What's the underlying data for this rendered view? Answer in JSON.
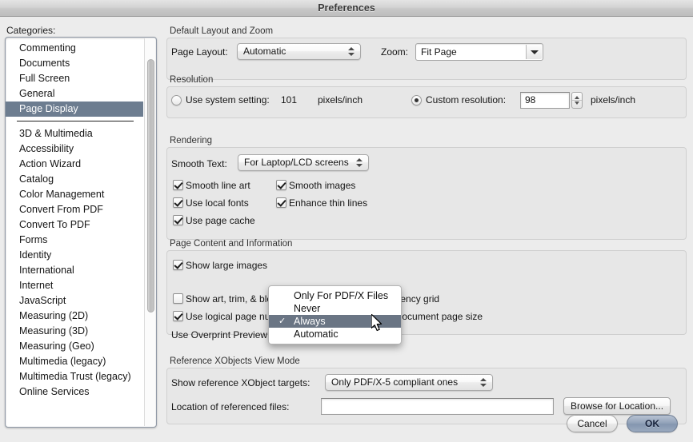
{
  "window": {
    "title": "Preferences"
  },
  "sidebar": {
    "label": "Categories:",
    "items": [
      {
        "label": "Commenting",
        "selected": false
      },
      {
        "label": "Documents",
        "selected": false
      },
      {
        "label": "Full Screen",
        "selected": false
      },
      {
        "label": "General",
        "selected": false
      },
      {
        "label": "Page Display",
        "selected": true
      }
    ],
    "items2": [
      {
        "label": "3D & Multimedia"
      },
      {
        "label": "Accessibility"
      },
      {
        "label": "Action Wizard"
      },
      {
        "label": "Catalog"
      },
      {
        "label": "Color Management"
      },
      {
        "label": "Convert From PDF"
      },
      {
        "label": "Convert To PDF"
      },
      {
        "label": "Forms"
      },
      {
        "label": "Identity"
      },
      {
        "label": "International"
      },
      {
        "label": "Internet"
      },
      {
        "label": "JavaScript"
      },
      {
        "label": "Measuring (2D)"
      },
      {
        "label": "Measuring (3D)"
      },
      {
        "label": "Measuring (Geo)"
      },
      {
        "label": "Multimedia (legacy)"
      },
      {
        "label": "Multimedia Trust (legacy)"
      },
      {
        "label": "Online Services"
      }
    ]
  },
  "layout_zoom": {
    "group_title": "Default Layout and Zoom",
    "page_layout_label": "Page Layout:",
    "page_layout_value": "Automatic",
    "zoom_label": "Zoom:",
    "zoom_value": "Fit Page"
  },
  "resolution": {
    "group_title": "Resolution",
    "system_label": "Use system setting:",
    "system_value": "101",
    "system_units": "pixels/inch",
    "system_selected": false,
    "custom_label": "Custom resolution:",
    "custom_value": "98",
    "custom_units": "pixels/inch",
    "custom_selected": true
  },
  "rendering": {
    "group_title": "Rendering",
    "smooth_text_label": "Smooth Text:",
    "smooth_text_value": "For Laptop/LCD screens",
    "checks": [
      {
        "label": "Smooth line art",
        "checked": true
      },
      {
        "label": "Smooth images",
        "checked": true
      },
      {
        "label": "Use local fonts",
        "checked": true
      },
      {
        "label": "Enhance thin lines",
        "checked": true
      },
      {
        "label": "Use page cache",
        "checked": true
      }
    ]
  },
  "page_content": {
    "group_title": "Page Content and Information",
    "show_large_images": {
      "label": "Show large images",
      "checked": true
    },
    "show_art_trim_bleed": {
      "label": "Show art, trim, & bleed boxes",
      "checked": false
    },
    "show_transparency_grid": {
      "label": "Show transparency grid",
      "checked": false
    },
    "use_logical_page_numbers": {
      "label": "Use logical page numbers",
      "checked": true
    },
    "always_show_doc_page_size": {
      "label": "Always show document page size",
      "checked": false
    },
    "overprint_label": "Use Overprint Preview:"
  },
  "overprint_menu": {
    "items": [
      {
        "label": "Only For PDF/X Files",
        "checked": false,
        "highlighted": false
      },
      {
        "label": "Never",
        "checked": false,
        "highlighted": false
      },
      {
        "label": "Always",
        "checked": true,
        "highlighted": true
      },
      {
        "label": "Automatic",
        "checked": false,
        "highlighted": false
      }
    ],
    "check_glyph": "✓"
  },
  "reference_xobjects": {
    "group_title": "Reference XObjects View Mode",
    "targets_label": "Show reference XObject targets:",
    "targets_value": "Only PDF/X-5 compliant ones",
    "location_label": "Location of referenced files:",
    "location_value": "",
    "browse_label": "Browse for Location..."
  },
  "footer": {
    "cancel_label": "Cancel",
    "ok_label": "OK"
  },
  "colors": {
    "selection": "#6d7d90",
    "menu_highlight": "#6a7584",
    "window_bg": "#ececec",
    "group_bg": "#e7e7e7"
  }
}
